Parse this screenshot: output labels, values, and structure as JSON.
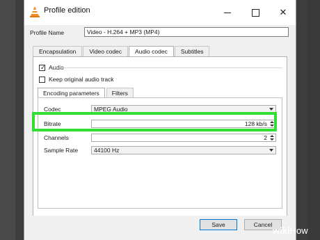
{
  "window": {
    "title": "Profile edition",
    "icon": "vlc-cone-icon"
  },
  "profile": {
    "label": "Profile Name",
    "value": "Video - H.264 + MP3 (MP4)"
  },
  "tabs": [
    {
      "label": "Encapsulation",
      "active": false
    },
    {
      "label": "Video codec",
      "active": false
    },
    {
      "label": "Audio codec",
      "active": true
    },
    {
      "label": "Subtitles",
      "active": false
    }
  ],
  "audio": {
    "enabled_label": "Audio",
    "enabled": true,
    "keep_original_label": "Keep original audio track",
    "keep_original": false
  },
  "subtabs": [
    {
      "label": "Encoding parameters",
      "active": true
    },
    {
      "label": "Filters",
      "active": false
    }
  ],
  "fields": {
    "codec": {
      "label": "Codec",
      "value": "MPEG Audio"
    },
    "bitrate": {
      "label": "Bitrate",
      "value": "128 kb/s"
    },
    "channels": {
      "label": "Channels",
      "value": "2"
    },
    "sample_rate": {
      "label": "Sample Rate",
      "value": "44100 Hz"
    }
  },
  "buttons": {
    "save": "Save",
    "cancel": "Cancel"
  },
  "highlight_color": "#33dd33",
  "watermark": {
    "wiki": "wiki",
    "how": "How"
  }
}
